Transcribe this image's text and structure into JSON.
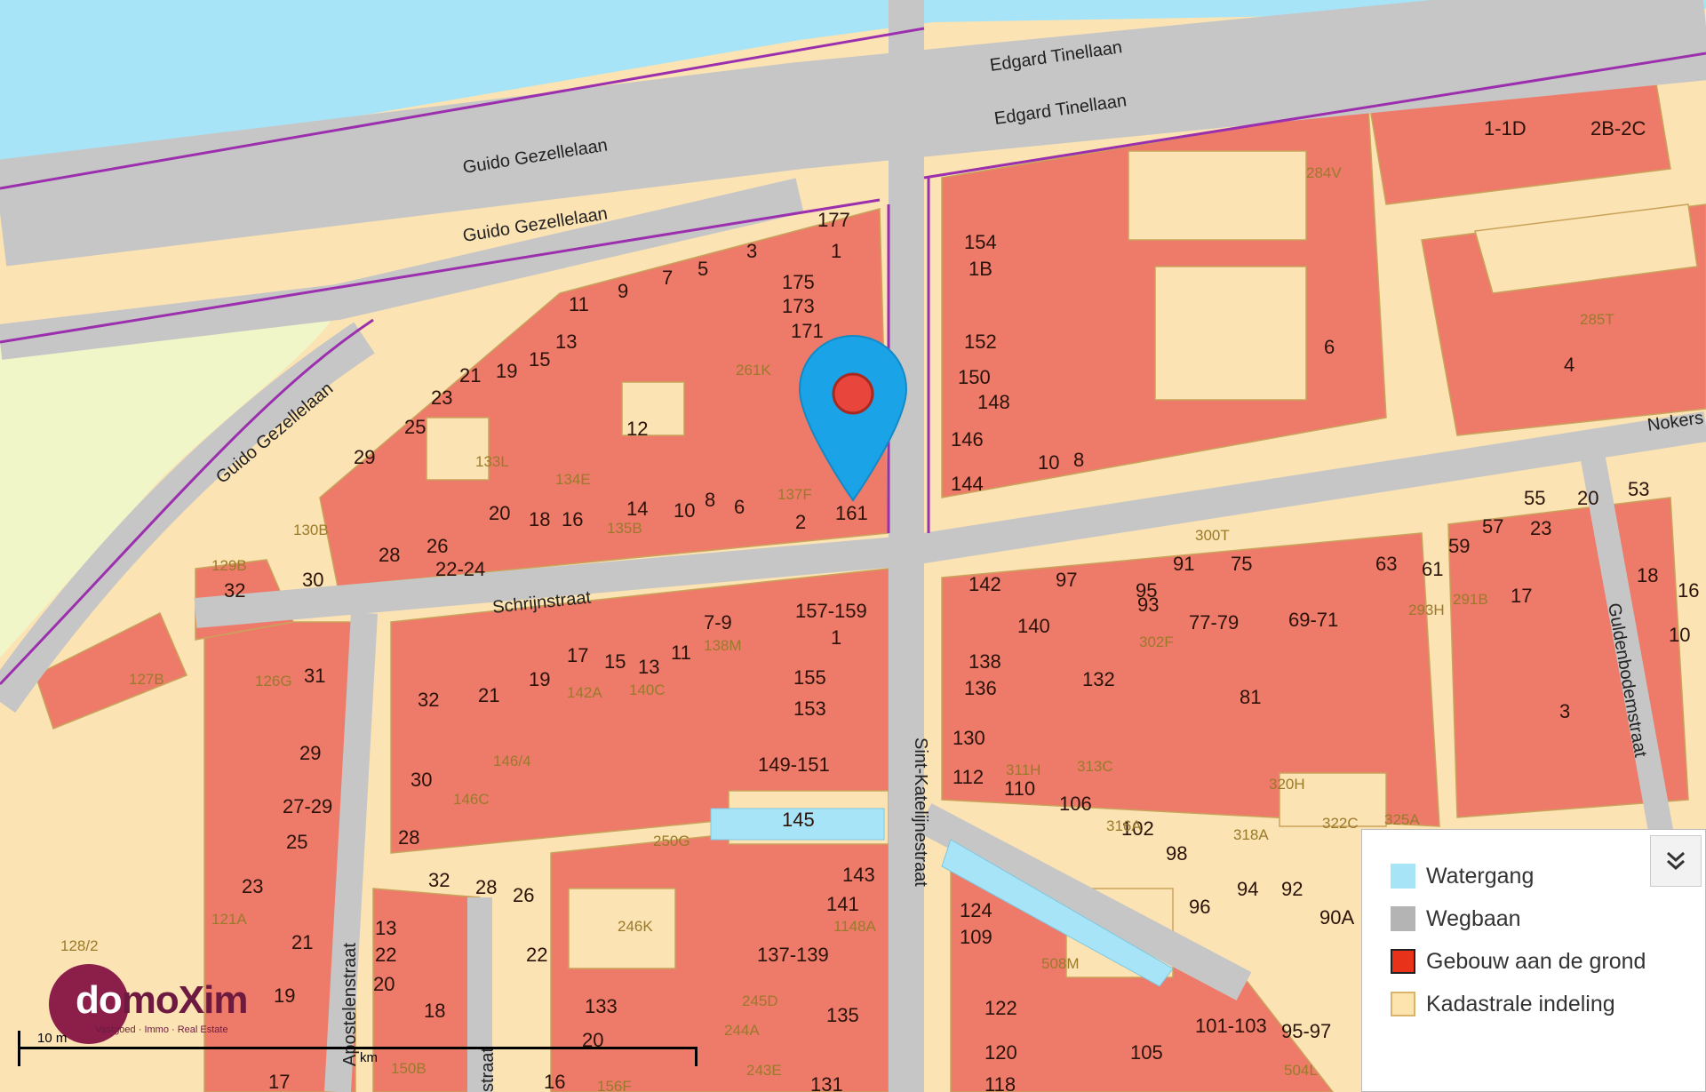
{
  "map": {
    "streets": [
      "Edgard Tinellaan",
      "Edgard Tinellaan",
      "Guido Gezellelaan",
      "Guido Gezellelaan",
      "Guido Gezellelaan",
      "Schrijnstraat",
      "Sint-Katelijnestraat",
      "Nokers",
      "Guldenbodemstraat",
      "Apostelenstraat",
      "straat"
    ],
    "building_numbers": [
      "177",
      "1",
      "175",
      "173",
      "171",
      "3",
      "5",
      "7",
      "9",
      "11",
      "13",
      "15",
      "19",
      "21",
      "23",
      "25",
      "29",
      "12",
      "20",
      "18",
      "16",
      "14",
      "10",
      "8",
      "6",
      "2",
      "161",
      "28",
      "26",
      "22-24",
      "30",
      "32",
      "154",
      "1B",
      "152",
      "150",
      "148",
      "146",
      "144",
      "10",
      "8",
      "6",
      "4",
      "1-1D",
      "2B-2C",
      "142",
      "97",
      "95",
      "93",
      "91",
      "75",
      "140",
      "138",
      "136",
      "132",
      "77-79",
      "69-71",
      "63",
      "61",
      "59",
      "57",
      "55",
      "23",
      "20",
      "53",
      "18",
      "16",
      "10",
      "17",
      "81",
      "3",
      "157-159",
      "1",
      "7-9",
      "11",
      "13",
      "15",
      "17",
      "19",
      "21",
      "32",
      "155",
      "153",
      "149-151",
      "145",
      "143",
      "141",
      "137-139",
      "135",
      "133",
      "20",
      "16",
      "31",
      "29",
      "27-29",
      "25",
      "23",
      "21",
      "19",
      "17",
      "30",
      "28",
      "32",
      "28",
      "26",
      "22",
      "13",
      "22",
      "20",
      "18",
      "130",
      "112",
      "110",
      "106",
      "102",
      "98",
      "96",
      "94",
      "92",
      "90A",
      "124",
      "109",
      "122",
      "120",
      "118",
      "131",
      "105",
      "101-103",
      "95-97"
    ],
    "parcel_ids": [
      "284V",
      "285T",
      "261K",
      "133L",
      "134E",
      "137F",
      "135B",
      "130B",
      "129B",
      "300T",
      "302F",
      "293H",
      "291B",
      "127B",
      "126G",
      "142A",
      "140C",
      "138M",
      "146/4",
      "146C",
      "250G",
      "246K",
      "245D",
      "244A",
      "243E",
      "156F",
      "150B",
      "121A",
      "128/2",
      "1148A",
      "311H",
      "313C",
      "316A",
      "318A",
      "320H",
      "322C",
      "325A",
      "508M",
      "504L"
    ]
  },
  "legend": {
    "items": [
      {
        "label": "Watergang",
        "color": "#a8e4f7"
      },
      {
        "label": "Wegbaan",
        "color": "#b4b4b4"
      },
      {
        "label": "Gebouw aan de grond",
        "color": "#e8331a"
      },
      {
        "label": "Kadastrale indeling",
        "color": "#fde3ae"
      }
    ],
    "toggle_icon": "chevron-double-down-icon"
  },
  "logo": {
    "brand": "domoXim",
    "brand_prefix": "do",
    "brand_suffix": "moXim",
    "tagline": "Vastgoed · Immo · Real Estate"
  },
  "scale": {
    "label_left": "10 m",
    "label_mid": "km"
  },
  "marker": {
    "icon": "location-pin-icon",
    "color": "#1aa3e6"
  },
  "colors": {
    "building": "#ee7b6a",
    "parcel": "#fbe3b3",
    "road": "#c6c6c6",
    "water": "#a8e4f7",
    "admin_boundary": "#9b2fae",
    "accent": "#8b1f4a"
  }
}
